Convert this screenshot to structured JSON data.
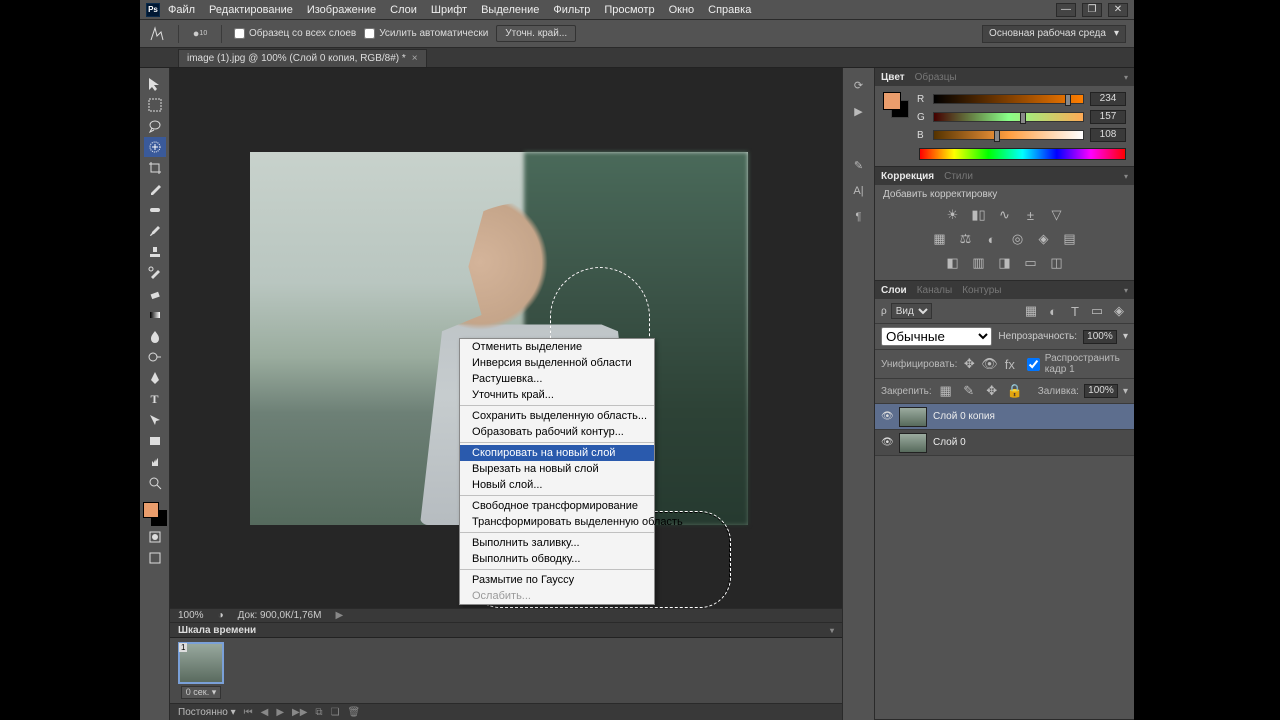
{
  "app": {
    "logo": "Ps"
  },
  "menu_bar": [
    "Файл",
    "Редактирование",
    "Изображение",
    "Слои",
    "Шрифт",
    "Выделение",
    "Фильтр",
    "Просмотр",
    "Окно",
    "Справка"
  ],
  "window_controls": {
    "min": "—",
    "max": "❐",
    "close": "✕"
  },
  "options_bar": {
    "brush_size": "10",
    "chk_sample_all": "Образец со всех слоев",
    "chk_auto_enhance": "Усилить автоматически",
    "btn_refine": "Уточн. край...",
    "workspace": "Основная рабочая среда"
  },
  "document_tab": {
    "label": "image (1).jpg @ 100% (Слой 0 копия, RGB/8#) *"
  },
  "canvas_status": {
    "zoom": "100%",
    "doc": "Док: 900,0К/1,76М"
  },
  "context_menu": {
    "items": [
      {
        "label": "Отменить выделение",
        "type": "item"
      },
      {
        "label": "Инверсия выделенной области",
        "type": "item"
      },
      {
        "label": "Растушевка...",
        "type": "item"
      },
      {
        "label": "Уточнить край...",
        "type": "item"
      },
      {
        "type": "sep"
      },
      {
        "label": "Сохранить выделенную область...",
        "type": "item"
      },
      {
        "label": "Образовать рабочий контур...",
        "type": "item"
      },
      {
        "type": "sep"
      },
      {
        "label": "Скопировать на новый слой",
        "type": "item",
        "hl": true
      },
      {
        "label": "Вырезать на новый слой",
        "type": "item"
      },
      {
        "label": "Новый слой...",
        "type": "item"
      },
      {
        "type": "sep"
      },
      {
        "label": "Свободное трансформирование",
        "type": "item"
      },
      {
        "label": "Трансформировать выделенную область",
        "type": "item"
      },
      {
        "type": "sep"
      },
      {
        "label": "Выполнить заливку...",
        "type": "item"
      },
      {
        "label": "Выполнить обводку...",
        "type": "item"
      },
      {
        "type": "sep"
      },
      {
        "label": "Размытие по Гауссу",
        "type": "item"
      },
      {
        "label": "Ослабить...",
        "type": "item",
        "disabled": true
      }
    ]
  },
  "timeline": {
    "tab": "Шкала времени",
    "duration": "0 сек.",
    "frame_no": "1",
    "mode": "Постоянно"
  },
  "panels": {
    "color": {
      "tabs": [
        "Цвет",
        "Образцы"
      ],
      "r": 234,
      "g": 157,
      "b": 108,
      "fg_hex": "#ea9d6c"
    },
    "adjustments": {
      "tabs": [
        "Коррекция",
        "Стили"
      ],
      "label": "Добавить корректировку"
    },
    "layers": {
      "tabs": [
        "Слои",
        "Каналы",
        "Контуры"
      ],
      "kind": "Вид",
      "blend_mode": "Обычные",
      "opacity_label": "Непрозрачность:",
      "opacity": "100%",
      "unify_label": "Унифицировать:",
      "propagate_label": "Распространить кадр 1",
      "lock_label": "Закрепить:",
      "fill_label": "Заливка:",
      "fill": "100%",
      "items": [
        {
          "name": "Слой 0 копия",
          "selected": true
        },
        {
          "name": "Слой 0",
          "selected": false
        }
      ]
    }
  }
}
